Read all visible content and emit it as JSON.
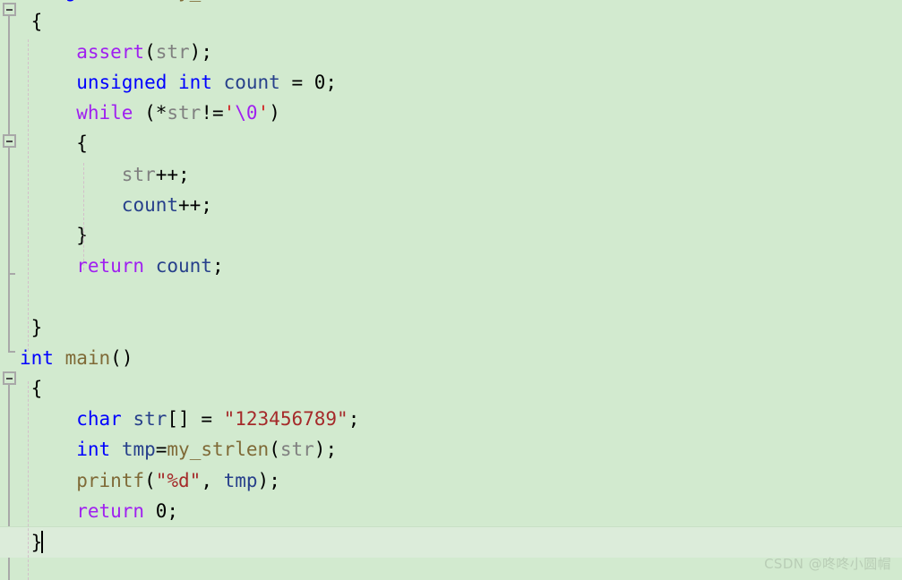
{
  "editor": {
    "background_color": "#d2eacf",
    "current_line_color": "#dcecda",
    "language": "C",
    "font_size_px": 21
  },
  "watermark": {
    "text": "CSDN @咚咚小圆帽"
  },
  "gutter": {
    "fold_markers": [
      {
        "name": "fold-marker-my-strlen",
        "state": "expanded",
        "symbol": "−"
      },
      {
        "name": "fold-marker-while",
        "state": "expanded",
        "symbol": "−"
      },
      {
        "name": "fold-marker-main",
        "state": "expanded",
        "symbol": "−"
      }
    ]
  },
  "caret": {
    "visible": true,
    "line_index": 15,
    "column": 1
  },
  "code": {
    "lines": [
      {
        "index": 0,
        "text": "unsigned int my_strlen(const char* str)",
        "tokens": [
          {
            "t": "unsigned int",
            "c": "kw"
          },
          {
            "t": " ",
            "c": "punct"
          },
          {
            "t": "my_strlen",
            "c": "fn"
          },
          {
            "t": "(",
            "c": "punct"
          },
          {
            "t": "const char",
            "c": "kw"
          },
          {
            "t": "* ",
            "c": "punct"
          },
          {
            "t": "str",
            "c": "param"
          },
          {
            "t": ")",
            "c": "punct"
          }
        ]
      },
      {
        "index": 1,
        "text": " {",
        "tokens": [
          {
            "t": " {",
            "c": "punct"
          }
        ]
      },
      {
        "index": 2,
        "text": "     assert(str);",
        "tokens": [
          {
            "t": "     ",
            "c": "punct"
          },
          {
            "t": "assert",
            "c": "macro"
          },
          {
            "t": "(",
            "c": "punct"
          },
          {
            "t": "str",
            "c": "param"
          },
          {
            "t": ");",
            "c": "punct"
          }
        ]
      },
      {
        "index": 3,
        "text": "     unsigned int count = 0;",
        "tokens": [
          {
            "t": "     ",
            "c": "punct"
          },
          {
            "t": "unsigned int",
            "c": "kw"
          },
          {
            "t": " ",
            "c": "punct"
          },
          {
            "t": "count",
            "c": "var"
          },
          {
            "t": " = ",
            "c": "punct"
          },
          {
            "t": "0",
            "c": "num"
          },
          {
            "t": ";",
            "c": "punct"
          }
        ]
      },
      {
        "index": 4,
        "text": "     while (*str!='\\0')",
        "tokens": [
          {
            "t": "     ",
            "c": "punct"
          },
          {
            "t": "while",
            "c": "ctrl"
          },
          {
            "t": " (*",
            "c": "punct"
          },
          {
            "t": "str",
            "c": "param"
          },
          {
            "t": "!=",
            "c": "punct"
          },
          {
            "t": "'",
            "c": "quote"
          },
          {
            "t": "\\0",
            "c": "esc"
          },
          {
            "t": "'",
            "c": "quote"
          },
          {
            "t": ")",
            "c": "punct"
          }
        ]
      },
      {
        "index": 5,
        "text": "     {",
        "tokens": [
          {
            "t": "     {",
            "c": "punct"
          }
        ]
      },
      {
        "index": 6,
        "text": "         str++;",
        "tokens": [
          {
            "t": "         ",
            "c": "punct"
          },
          {
            "t": "str",
            "c": "param"
          },
          {
            "t": "++;",
            "c": "punct"
          }
        ]
      },
      {
        "index": 7,
        "text": "         count++;",
        "tokens": [
          {
            "t": "         ",
            "c": "punct"
          },
          {
            "t": "count",
            "c": "var"
          },
          {
            "t": "++;",
            "c": "punct"
          }
        ]
      },
      {
        "index": 8,
        "text": "     }",
        "tokens": [
          {
            "t": "     }",
            "c": "punct"
          }
        ]
      },
      {
        "index": 9,
        "text": "     return count;",
        "tokens": [
          {
            "t": "     ",
            "c": "punct"
          },
          {
            "t": "return",
            "c": "ctrl"
          },
          {
            "t": " ",
            "c": "punct"
          },
          {
            "t": "count",
            "c": "var"
          },
          {
            "t": ";",
            "c": "punct"
          }
        ]
      },
      {
        "index": 10,
        "text": "",
        "tokens": []
      },
      {
        "index": 11,
        "text": " }",
        "tokens": [
          {
            "t": " }",
            "c": "punct"
          }
        ]
      },
      {
        "index": 12,
        "text": "int main()",
        "tokens": [
          {
            "t": "int",
            "c": "kw"
          },
          {
            "t": " ",
            "c": "punct"
          },
          {
            "t": "main",
            "c": "fn"
          },
          {
            "t": "()",
            "c": "punct"
          }
        ]
      },
      {
        "index": 13,
        "text": " {",
        "tokens": [
          {
            "t": " {",
            "c": "punct"
          }
        ]
      },
      {
        "index": 14,
        "text": "     char str[] = \"123456789\";",
        "tokens": [
          {
            "t": "     ",
            "c": "punct"
          },
          {
            "t": "char",
            "c": "kw"
          },
          {
            "t": " ",
            "c": "punct"
          },
          {
            "t": "str",
            "c": "var"
          },
          {
            "t": "[] = ",
            "c": "punct"
          },
          {
            "t": "\"123456789\"",
            "c": "str"
          },
          {
            "t": ";",
            "c": "punct"
          }
        ]
      },
      {
        "index": 15,
        "text": "     int tmp=my_strlen(str);",
        "tokens": [
          {
            "t": "     ",
            "c": "punct"
          },
          {
            "t": "int",
            "c": "kw"
          },
          {
            "t": " ",
            "c": "punct"
          },
          {
            "t": "tmp",
            "c": "var"
          },
          {
            "t": "=",
            "c": "punct"
          },
          {
            "t": "my_strlen",
            "c": "fn"
          },
          {
            "t": "(",
            "c": "punct"
          },
          {
            "t": "str",
            "c": "param"
          },
          {
            "t": ");",
            "c": "punct"
          }
        ]
      },
      {
        "index": 16,
        "text": "     printf(\"%d\", tmp);",
        "tokens": [
          {
            "t": "     ",
            "c": "punct"
          },
          {
            "t": "printf",
            "c": "fn"
          },
          {
            "t": "(",
            "c": "punct"
          },
          {
            "t": "\"%d\"",
            "c": "str"
          },
          {
            "t": ", ",
            "c": "punct"
          },
          {
            "t": "tmp",
            "c": "var"
          },
          {
            "t": ");",
            "c": "punct"
          }
        ]
      },
      {
        "index": 17,
        "text": "     return 0;",
        "tokens": [
          {
            "t": "     ",
            "c": "punct"
          },
          {
            "t": "return",
            "c": "ctrl"
          },
          {
            "t": " ",
            "c": "punct"
          },
          {
            "t": "0",
            "c": "num"
          },
          {
            "t": ";",
            "c": "punct"
          }
        ]
      },
      {
        "index": 18,
        "text": " }",
        "tokens": [
          {
            "t": " }",
            "c": "punct"
          }
        ],
        "current": true,
        "caret_after": true
      }
    ]
  }
}
